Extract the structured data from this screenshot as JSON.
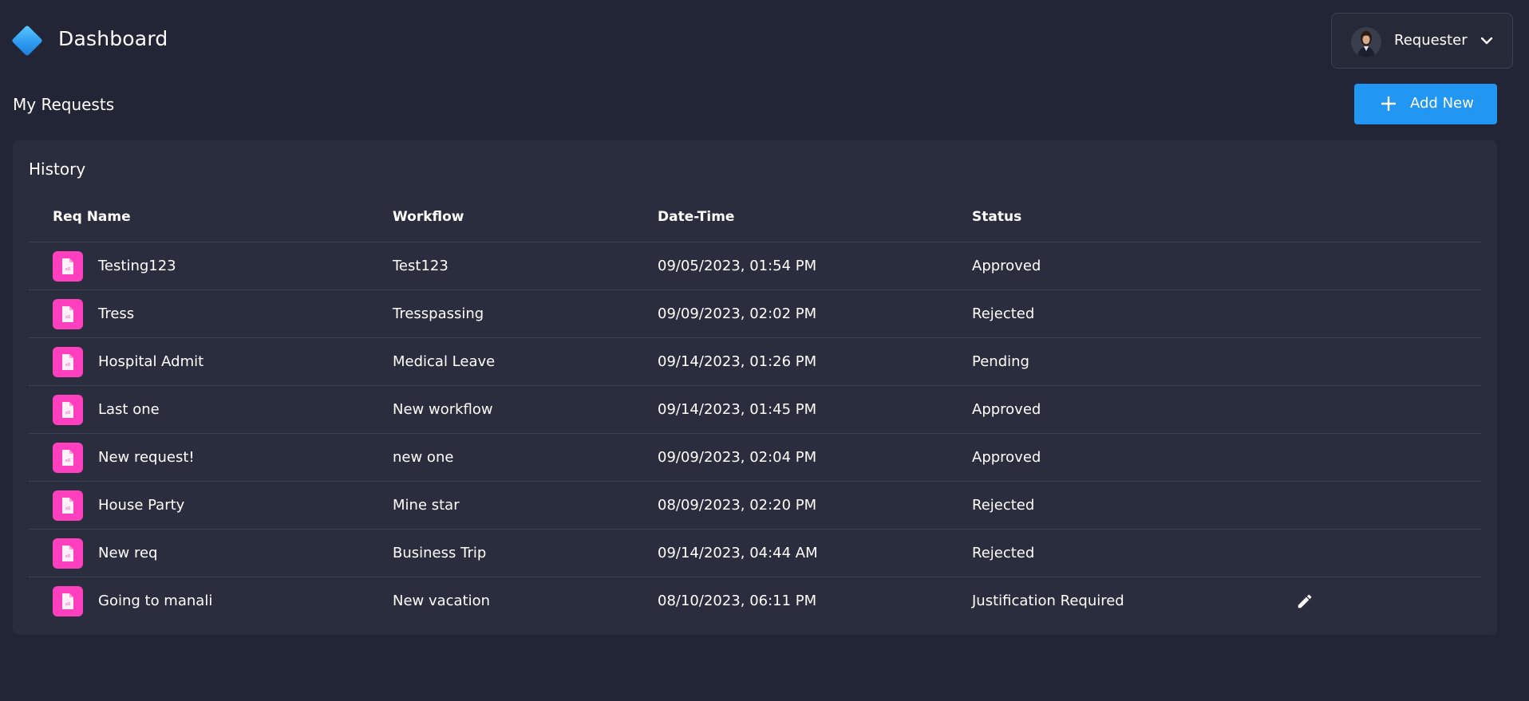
{
  "header": {
    "title": "Dashboard",
    "user_role": "Requester"
  },
  "section_title": "My Requests",
  "add_button_label": "Add New",
  "card": {
    "title": "History",
    "columns": [
      "Req Name",
      "Workflow",
      "Date-Time",
      "Status"
    ]
  },
  "rows": [
    {
      "name": "Testing123",
      "workflow": "Test123",
      "datetime": "09/05/2023, 01:54 PM",
      "status": "Approved"
    },
    {
      "name": "Tress",
      "workflow": "Tresspassing",
      "datetime": "09/09/2023, 02:02 PM",
      "status": "Rejected"
    },
    {
      "name": "Hospital Admit",
      "workflow": "Medical Leave",
      "datetime": "09/14/2023, 01:26 PM",
      "status": "Pending"
    },
    {
      "name": "Last one",
      "workflow": "New workflow",
      "datetime": "09/14/2023, 01:45 PM",
      "status": "Approved"
    },
    {
      "name": "New request!",
      "workflow": "new one",
      "datetime": "09/09/2023, 02:04 PM",
      "status": "Approved"
    },
    {
      "name": "House Party",
      "workflow": "Mine star",
      "datetime": "08/09/2023, 02:20 PM",
      "status": "Rejected"
    },
    {
      "name": "New req",
      "workflow": "Business Trip",
      "datetime": "09/14/2023, 04:44 AM",
      "status": "Rejected"
    },
    {
      "name": "Going to manali",
      "workflow": "New vacation",
      "datetime": "08/10/2023, 06:11 PM",
      "status": "Justification Required"
    }
  ],
  "colors": {
    "background": "#222535",
    "card": "#2a2d3e",
    "accent_blue": "#2196f3",
    "file_icon_pink": "#ff3fbe"
  }
}
